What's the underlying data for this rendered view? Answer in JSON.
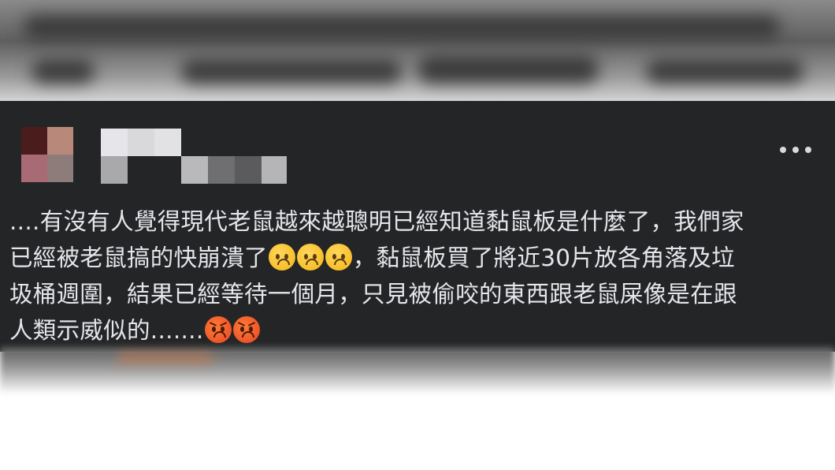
{
  "post": {
    "text_line_1": "....有沒有人覺得現代老鼠越來越聰明已經知道黏鼠板是什麼了，我們家",
    "text_line_2a": "已經被老鼠搞的快崩潰了",
    "text_line_2b": "，黏鼠板買了將近30片放各角落及垃",
    "text_line_3": "圾桶週圍，結果已經等待一個月，只見被偷咬的東西跟老鼠屎像是在跟",
    "text_line_4": "人類示威似的.......",
    "emojis_line_2": [
      "sad-face-icon",
      "sad-face-icon",
      "sad-face-icon"
    ],
    "emojis_line_4": [
      "angry-face-icon",
      "angry-face-icon"
    ]
  },
  "colors": {
    "card_background": "#242526",
    "text": "#e4e6eb",
    "more_dots": "#d8dadf"
  }
}
